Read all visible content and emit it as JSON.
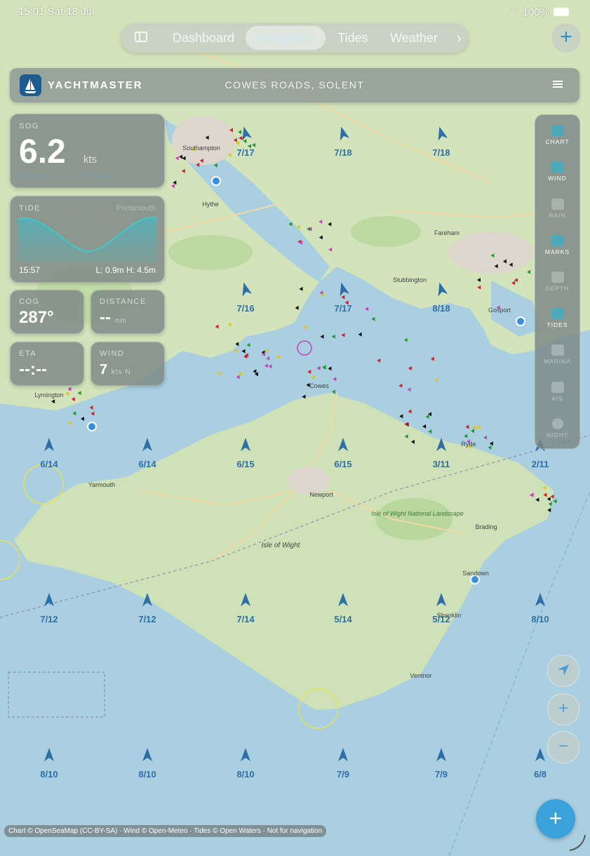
{
  "status": {
    "time": "15:01",
    "date": "Sat 18 Jul",
    "battery": "100%"
  },
  "tabs": [
    {
      "label": "Dashboard",
      "active": false
    },
    {
      "label": "Navigation",
      "active": true
    },
    {
      "label": "Tides",
      "active": false
    },
    {
      "label": "Weather",
      "active": false
    }
  ],
  "header": {
    "brand": "YACHTMASTER",
    "location": "COWES ROADS, SOLENT"
  },
  "sog": {
    "label": "SOG",
    "value": "6.2",
    "unit": "kts",
    "sub": "SPEED OVER GROUND"
  },
  "tide": {
    "label": "TIDE",
    "source": "Portsmouth",
    "time": "15:57",
    "low": "L: 0.9m",
    "high": "H: 4.5m"
  },
  "cog": {
    "label": "COG",
    "value": "287°"
  },
  "distance": {
    "label": "DISTANCE",
    "value": "--",
    "unit": "nm"
  },
  "eta": {
    "label": "ETA",
    "value": "--:--"
  },
  "wind": {
    "label": "WIND",
    "value": "7",
    "unit": "kts N"
  },
  "layers": [
    {
      "label": "CHART",
      "icon": "chart-icon",
      "on": true
    },
    {
      "label": "WIND",
      "icon": "wind-icon",
      "on": true
    },
    {
      "label": "RAIN",
      "icon": "rain-icon",
      "on": false
    },
    {
      "label": "MARKS",
      "icon": "marks-icon",
      "on": true
    },
    {
      "label": "DEPTH",
      "icon": "depth-icon",
      "on": false
    },
    {
      "label": "TIDES",
      "icon": "tides-icon",
      "on": true
    },
    {
      "label": "MARINA",
      "icon": "marina-icon",
      "on": false
    },
    {
      "label": "AIS",
      "icon": "ais-icon",
      "on": false
    },
    {
      "label": "NIGHT",
      "icon": "night-icon",
      "on": false
    }
  ],
  "map": {
    "place_labels": [
      {
        "text": "Southampton"
      },
      {
        "text": "Hythe"
      },
      {
        "text": "Fareham"
      },
      {
        "text": "Gosport"
      },
      {
        "text": "Lymington"
      },
      {
        "text": "Cowes"
      },
      {
        "text": "Ryde"
      },
      {
        "text": "Newport"
      },
      {
        "text": "Isle of Wight"
      },
      {
        "text": "Isle of Wight National Landscape"
      },
      {
        "text": "Sandown"
      },
      {
        "text": "Ventnor"
      },
      {
        "text": "Yarmouth"
      },
      {
        "text": "Stubbington"
      },
      {
        "text": "Brading"
      },
      {
        "text": "Shanklin"
      }
    ],
    "wind_labels": [
      "7/17",
      "7/18",
      "7/18",
      "7/16",
      "7/17",
      "8/18",
      "6/14",
      "6/14",
      "6/15",
      "6/15",
      "3/11",
      "2/11",
      "7/12",
      "7/12",
      "7/14",
      "5/14",
      "5/12",
      "8/10",
      "8/10",
      "8/10",
      "8/10",
      "7/9",
      "7/9",
      "6/8"
    ]
  },
  "attribution": "Chart © OpenSeaMap (CC-BY-SA) · Wind © Open-Meteo · Tides © Open Waters · Not for navigation",
  "colors": {
    "water": "#a9cfe0",
    "land": "#cfe1b6",
    "accent": "#3aa2d8",
    "wind": "#2f6fa8"
  }
}
